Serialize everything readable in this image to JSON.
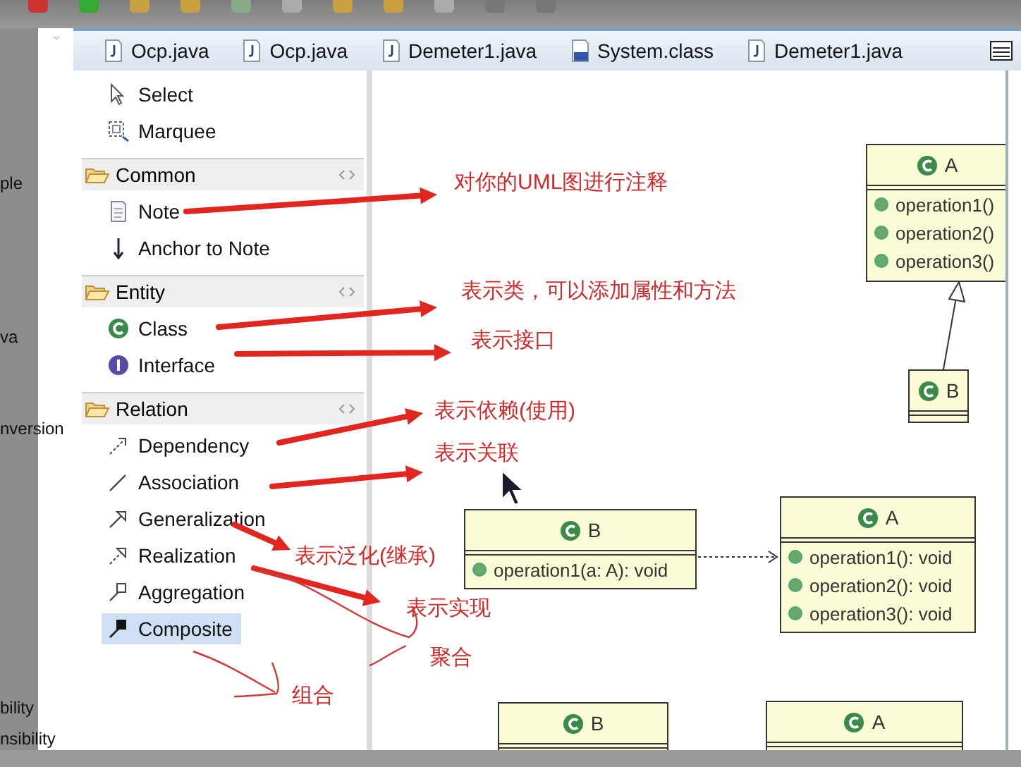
{
  "side_panel": {
    "texts": [
      "ple",
      "va",
      "nversion",
      "bility",
      "nsibility"
    ]
  },
  "tabs": [
    {
      "label": "Ocp.java",
      "kind": "java",
      "selected": false
    },
    {
      "label": "Ocp.java",
      "kind": "java",
      "selected": false
    },
    {
      "label": "Demeter1.java",
      "kind": "java",
      "selected": false
    },
    {
      "label": "System.class",
      "kind": "class",
      "selected": false
    },
    {
      "label": "Demeter1.java",
      "kind": "java",
      "selected": false
    }
  ],
  "palette": {
    "tools": [
      {
        "label": "Select",
        "kind": "select",
        "selected": false
      },
      {
        "label": "Marquee",
        "kind": "marquee",
        "selected": false
      }
    ],
    "groups": [
      {
        "title": "Common",
        "items": [
          {
            "label": "Note",
            "kind": "note",
            "selected": false
          },
          {
            "label": "Anchor to Note",
            "kind": "anchor",
            "selected": false
          }
        ]
      },
      {
        "title": "Entity",
        "items": [
          {
            "label": "Class",
            "kind": "class",
            "selected": false
          },
          {
            "label": "Interface",
            "kind": "interface",
            "selected": false
          }
        ]
      },
      {
        "title": "Relation",
        "items": [
          {
            "label": "Dependency",
            "kind": "dependency",
            "selected": false
          },
          {
            "label": "Association",
            "kind": "association",
            "selected": false
          },
          {
            "label": "Generalization",
            "kind": "generalization",
            "selected": false
          },
          {
            "label": "Realization",
            "kind": "realization",
            "selected": false
          },
          {
            "label": "Aggregation",
            "kind": "aggregation",
            "selected": false
          },
          {
            "label": "Composite",
            "kind": "composite",
            "selected": true
          }
        ]
      }
    ]
  },
  "diagram": {
    "classes": [
      {
        "name": "A",
        "operations": [
          "operation1()",
          "operation2()",
          "operation3()"
        ]
      },
      {
        "name": "B"
      },
      {
        "name": "B",
        "operations": [
          "operation1(a: A): void"
        ]
      },
      {
        "name": "A",
        "operations": [
          "operation1(): void",
          "operation2(): void",
          "operation3(): void"
        ]
      },
      {
        "name": "B"
      },
      {
        "name": "A"
      }
    ]
  },
  "annotations": [
    "对你的UML图进行注释",
    "表示类，可以添加属性和方法",
    "表示接口",
    "表示依赖(使用)",
    "表示关联",
    "表示泛化(继承)",
    "表示实现",
    "聚合",
    "组合"
  ]
}
